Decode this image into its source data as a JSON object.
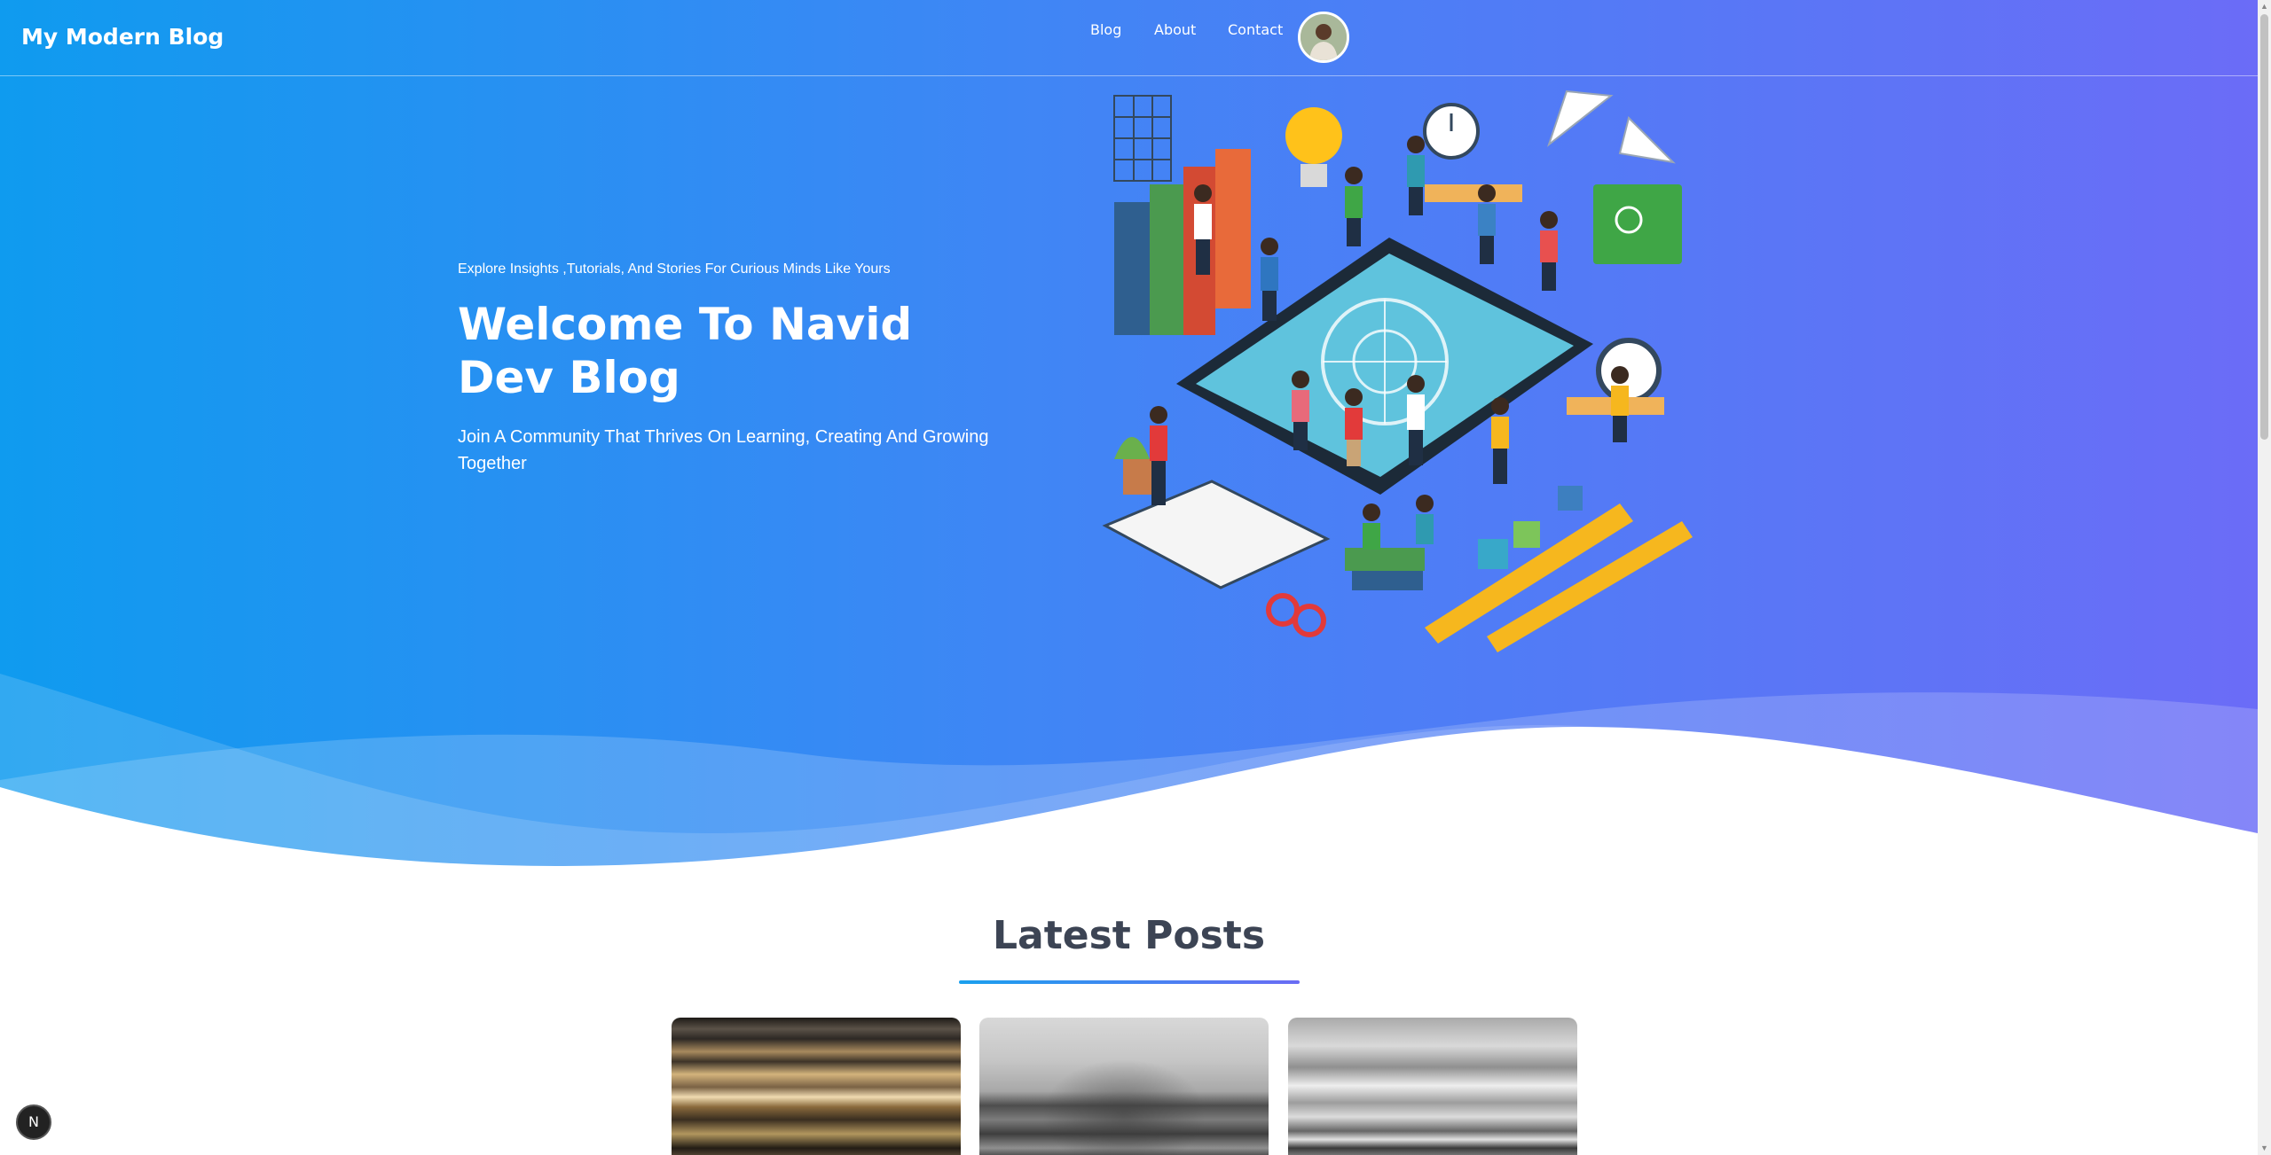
{
  "header": {
    "logo": "My Modern Blog",
    "nav": [
      {
        "label": "Blog"
      },
      {
        "label": "About"
      },
      {
        "label": "Contact"
      }
    ],
    "avatar_icon": "user-avatar-photo"
  },
  "hero": {
    "eyebrow": "Explore Insights ,Tutorials, And Stories For Curious Minds Like Yours",
    "title": "Welcome To Navid Dev Blog",
    "subtitle": "Join A Community That Thrives On Learning, Creating And Growing Together",
    "illustration_icon": "learning-community-illustration",
    "gradient": [
      "#0f9bef",
      "#3f86f5",
      "#6b6cf7"
    ]
  },
  "latest": {
    "title": "Latest Posts",
    "cards": [
      {
        "image": "blurred-golden-lines-image"
      },
      {
        "image": "grayscale-gravel-image"
      },
      {
        "image": "grayscale-seascape-image"
      }
    ]
  },
  "dev_badge": {
    "label": "N",
    "icon": "nextjs-dev-indicator-icon"
  }
}
